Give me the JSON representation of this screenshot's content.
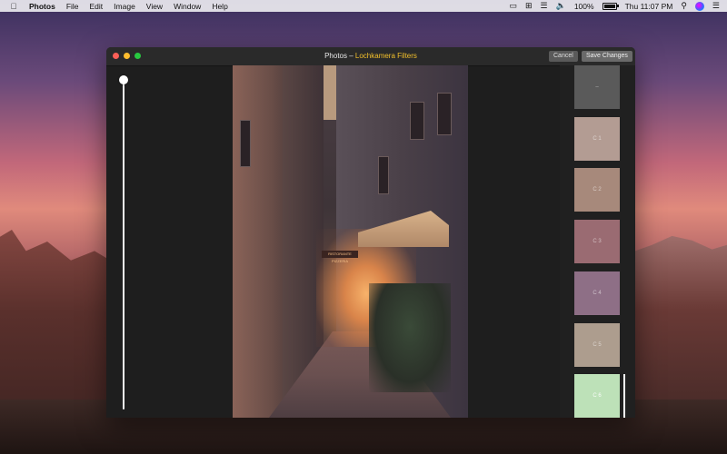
{
  "menubar": {
    "app": "Photos",
    "menus": [
      "File",
      "Edit",
      "Image",
      "View",
      "Window",
      "Help"
    ],
    "battery_text": "100%",
    "battery_level": 1.0,
    "clock": "Thu 11:07 PM"
  },
  "window": {
    "title_prefix": "Photos – ",
    "title_highlight": "Lochkamera Filters",
    "cancel_label": "Cancel",
    "save_label": "Save Changes",
    "highlight_color": "#f3c02b"
  },
  "slider": {
    "level": 1.0
  },
  "filters": [
    {
      "label": "–",
      "color": "#5a5a5a"
    },
    {
      "label": "C 1",
      "color": "#b39c93"
    },
    {
      "label": "C 2",
      "color": "#a7897b"
    },
    {
      "label": "C 3",
      "color": "#9a6b72"
    },
    {
      "label": "C 4",
      "color": "#8e6f86"
    },
    {
      "label": "C 5",
      "color": "#ad9d8e"
    },
    {
      "label": "C 6",
      "color": "#bde1b8",
      "selected": true
    }
  ],
  "photo": {
    "sign_text": "RISTORANTE PIZZERIA"
  }
}
